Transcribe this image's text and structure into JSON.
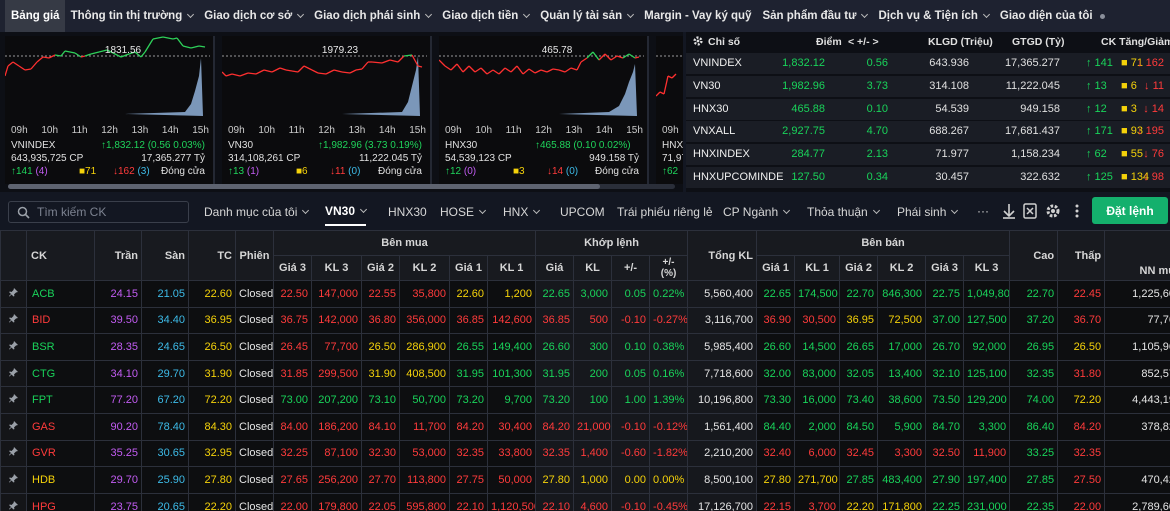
{
  "nav": {
    "items": [
      {
        "label": "Bảng giá",
        "chev": false,
        "dot": false,
        "active": true
      },
      {
        "label": "Thông tin thị trường",
        "chev": true,
        "dot": false
      },
      {
        "label": "Giao dịch cơ sở",
        "chev": true,
        "dot": false
      },
      {
        "label": "Giao dịch phái sinh",
        "chev": true,
        "dot": false
      },
      {
        "label": "Giao dịch tiền",
        "chev": true,
        "dot": false
      },
      {
        "label": "Quản lý tài sản",
        "chev": true,
        "dot": false
      },
      {
        "label": "Margin - Vay ký quỹ",
        "chev": false,
        "dot": false
      },
      {
        "label": "Sản phẩm đầu tư",
        "chev": true,
        "dot": false
      },
      {
        "label": "Dịch vụ & Tiện ích",
        "chev": true,
        "dot": false
      },
      {
        "label": "Giao diện của tôi",
        "chev": false,
        "dot": true
      }
    ]
  },
  "charts": [
    {
      "name": "VNINDEX",
      "ref_label": "1831.56",
      "change": "↑1,832.12 (0.56 0.03%)",
      "volume": "643,935,725 CP",
      "value": "17,365.277 Tỷ",
      "up": "↑141",
      "up_ceil": "(4)",
      "ref": "■71",
      "down": "↓162",
      "down_floor": "(3)",
      "status": "Đóng cửa",
      "ticks": [
        "09h",
        "10h",
        "11h",
        "12h",
        "13h",
        "14h",
        "15h"
      ],
      "intraday": [
        [
          0,
          40
        ],
        [
          3,
          30
        ],
        [
          8,
          26
        ],
        [
          14,
          30
        ],
        [
          20,
          34
        ],
        [
          26,
          33
        ],
        [
          32,
          26
        ],
        [
          38,
          21
        ],
        [
          44,
          22
        ],
        [
          50,
          19
        ],
        [
          56,
          20
        ],
        [
          60,
          15
        ],
        [
          70,
          17
        ],
        [
          76,
          21
        ],
        [
          80,
          20
        ],
        [
          86,
          18
        ],
        [
          94,
          16
        ],
        [
          102,
          14
        ],
        [
          108,
          17
        ],
        [
          116,
          21
        ],
        [
          124,
          18
        ],
        [
          130,
          16
        ],
        [
          136,
          21
        ],
        [
          140,
          16
        ],
        [
          148,
          3
        ],
        [
          158,
          1
        ],
        [
          168,
          3
        ],
        [
          172,
          2
        ],
        [
          178,
          10
        ],
        [
          186,
          12
        ],
        [
          194,
          10
        ],
        [
          200,
          11
        ]
      ],
      "volume_curve": [
        [
          120,
          78
        ],
        [
          180,
          76
        ],
        [
          186,
          68
        ],
        [
          190,
          55
        ],
        [
          194,
          40
        ],
        [
          196,
          22
        ],
        [
          198,
          80
        ]
      ]
    },
    {
      "name": "VN30",
      "ref_label": "1979.23",
      "change": "↑1,982.96 (3.73 0.19%)",
      "volume": "314,108,261 CP",
      "value": "11,222.045 Tỷ",
      "up": "↑13",
      "up_ceil": "(1)",
      "ref": "■6",
      "down": "↓11",
      "down_floor": "(0)",
      "status": "Đóng cửa",
      "ticks": [
        "09h",
        "10h",
        "11h",
        "12h",
        "13h",
        "14h",
        "15h"
      ],
      "intraday": [
        [
          0,
          36
        ],
        [
          4,
          40
        ],
        [
          10,
          38
        ],
        [
          18,
          40
        ],
        [
          26,
          37
        ],
        [
          34,
          38
        ],
        [
          42,
          34
        ],
        [
          50,
          36
        ],
        [
          58,
          32
        ],
        [
          64,
          34
        ],
        [
          70,
          35
        ],
        [
          76,
          36
        ],
        [
          82,
          30
        ],
        [
          90,
          34
        ],
        [
          96,
          37
        ],
        [
          104,
          38
        ],
        [
          112,
          34
        ],
        [
          120,
          36
        ],
        [
          128,
          37
        ],
        [
          134,
          34
        ],
        [
          140,
          33
        ],
        [
          146,
          26
        ],
        [
          150,
          26
        ],
        [
          160,
          27
        ],
        [
          168,
          24
        ],
        [
          176,
          26
        ],
        [
          182,
          20
        ],
        [
          190,
          19
        ],
        [
          196,
          30
        ],
        [
          200,
          31
        ]
      ],
      "volume_curve": [
        [
          120,
          78
        ],
        [
          180,
          76
        ],
        [
          186,
          66
        ],
        [
          190,
          50
        ],
        [
          194,
          34
        ],
        [
          196,
          20
        ],
        [
          198,
          80
        ]
      ]
    },
    {
      "name": "HNX30",
      "ref_label": "465.78",
      "change": "↑465.88 (0.10 0.02%)",
      "volume": "54,539,123 CP",
      "value": "949.158 Tỷ",
      "up": "↑12",
      "up_ceil": "(0)",
      "ref": "■3",
      "down": "↓14",
      "down_floor": "(0)",
      "status": "Đóng cửa",
      "ticks": [
        "09h",
        "10h",
        "11h",
        "12h",
        "13h",
        "14h",
        "15h"
      ],
      "intraday": [
        [
          0,
          24
        ],
        [
          6,
          30
        ],
        [
          12,
          34
        ],
        [
          18,
          28
        ],
        [
          24,
          36
        ],
        [
          30,
          30
        ],
        [
          36,
          36
        ],
        [
          42,
          32
        ],
        [
          48,
          38
        ],
        [
          54,
          34
        ],
        [
          60,
          38
        ],
        [
          66,
          32
        ],
        [
          72,
          36
        ],
        [
          78,
          30
        ],
        [
          84,
          38
        ],
        [
          90,
          33
        ],
        [
          96,
          37
        ],
        [
          102,
          34
        ],
        [
          108,
          36
        ],
        [
          114,
          33
        ],
        [
          120,
          34
        ],
        [
          126,
          36
        ],
        [
          132,
          32
        ],
        [
          138,
          34
        ],
        [
          142,
          26
        ],
        [
          148,
          22
        ],
        [
          154,
          16
        ],
        [
          160,
          24
        ],
        [
          166,
          18
        ],
        [
          172,
          24
        ],
        [
          178,
          20
        ],
        [
          184,
          22
        ],
        [
          190,
          18
        ],
        [
          196,
          22
        ],
        [
          200,
          21
        ]
      ],
      "volume_curve": [
        [
          120,
          78
        ],
        [
          170,
          76
        ],
        [
          180,
          70
        ],
        [
          186,
          58
        ],
        [
          190,
          46
        ],
        [
          194,
          36
        ],
        [
          196,
          28
        ],
        [
          198,
          80
        ]
      ]
    },
    {
      "name": "HNXINDEX",
      "ref_label": "",
      "change": "",
      "volume": "71,97",
      "value": "",
      "up": "↑62",
      "up_ceil": "",
      "ref": "",
      "down": "",
      "down_floor": "",
      "status": "",
      "ticks": [
        "09h",
        "10h"
      ],
      "intraday": [
        [
          0,
          60
        ],
        [
          4,
          56
        ],
        [
          8,
          58
        ],
        [
          12,
          40
        ],
        [
          16,
          42
        ],
        [
          20,
          38
        ]
      ],
      "volume_curve": [
        [
          0,
          80
        ],
        [
          20,
          80
        ]
      ]
    }
  ],
  "indices": {
    "headers": {
      "name": "Chỉ số",
      "point": "Điểm",
      "change": "< +/- >",
      "vol": "KLGD (Triệu)",
      "val": "GTGD (Tỷ)",
      "breadth": "CK Tăng/Giảm"
    },
    "rows": [
      {
        "name": "VNINDEX",
        "point": "1,832.12",
        "change": "0.56",
        "vol": "643.936",
        "val": "17,365.277",
        "up": "↑ 141",
        "ref": "■ 71",
        "down": "↓ 162"
      },
      {
        "name": "VN30",
        "point": "1,982.96",
        "change": "3.73",
        "vol": "314.108",
        "val": "11,222.045",
        "up": "↑ 13",
        "ref": "■ 6",
        "down": "↓ 11"
      },
      {
        "name": "HNX30",
        "point": "465.88",
        "change": "0.10",
        "vol": "54.539",
        "val": "949.158",
        "up": "↑ 12",
        "ref": "■ 3",
        "down": "↓ 14"
      },
      {
        "name": "VNXALL",
        "point": "2,927.75",
        "change": "4.70",
        "vol": "688.267",
        "val": "17,681.437",
        "up": "↑ 171",
        "ref": "■ 93",
        "down": "↓ 195"
      },
      {
        "name": "HNXINDEX",
        "point": "284.77",
        "change": "2.13",
        "vol": "71.977",
        "val": "1,158.234",
        "up": "↑ 62",
        "ref": "■ 55",
        "down": "↓ 76"
      },
      {
        "name": "HNXUPCOMINDE",
        "point": "127.50",
        "change": "0.34",
        "vol": "30.457",
        "val": "322.632",
        "up": "↑ 125",
        "ref": "■ 134",
        "down": "↓ 98"
      }
    ]
  },
  "toolbar": {
    "search_placeholder": "Tìm kiếm CK",
    "tabs": [
      {
        "label": "Danh mục của tôi",
        "chev": true
      },
      {
        "label": "VN30",
        "chev": true,
        "active": true
      },
      {
        "label": "HNX30",
        "chev": false
      },
      {
        "label": "HOSE",
        "chev": true
      },
      {
        "label": "HNX",
        "chev": true
      },
      {
        "label": "UPCOM",
        "chev": false
      },
      {
        "label": "Trái phiếu riêng lẻ",
        "chev": false
      },
      {
        "label": "CP Ngành",
        "chev": true
      },
      {
        "label": "Thỏa thuận",
        "chev": true
      },
      {
        "label": "Phái sinh",
        "chev": true
      }
    ],
    "more": "···",
    "order_button": "Đặt lệnh"
  },
  "board": {
    "headers": {
      "ck": "CK",
      "ceil": "Trần",
      "floor": "Sàn",
      "ref": "TC",
      "session": "Phiên",
      "buy_group": "Bên mua",
      "match_group": "Khớp lệnh",
      "total_vol": "Tổng KL",
      "sell_group": "Bên bán",
      "high": "Cao",
      "low": "Thấp",
      "foreign": "NN mua",
      "p3": "Giá 3",
      "v3": "KL 3",
      "p2": "Giá 2",
      "v2": "KL 2",
      "p1": "Giá 1",
      "v1": "KL 1",
      "mp": "Giá",
      "mv": "KL",
      "mchg": "+/-",
      "mpct": "+/-\n(%)"
    },
    "colors": {
      "up": "#19d35a",
      "down": "#ff3b3b",
      "ref": "#f5d20a",
      "ceil": "#c25cf2",
      "floor": "#3dbbe8",
      "text": "#e5e5e5"
    },
    "rows": [
      [
        "ACB",
        "24.15",
        "21.05",
        "22.60",
        "Closed",
        "22.50",
        "147,000",
        "22.55",
        "35,800",
        "22.60",
        "1,200",
        "22.65",
        "3,000",
        "0.05",
        "0.22%",
        "5,560,400",
        "22.65",
        "174,500",
        "22.70",
        "846,300",
        "22.75",
        "1,049,800",
        "22.70",
        "22.45",
        "1,225,600"
      ],
      [
        "BID",
        "39.50",
        "34.40",
        "36.95",
        "Closed",
        "36.75",
        "142,000",
        "36.80",
        "356,000",
        "36.85",
        "142,600",
        "36.85",
        "500",
        "-0.10",
        "-0.27%",
        "3,116,700",
        "36.90",
        "30,500",
        "36.95",
        "72,500",
        "37.00",
        "127,500",
        "37.20",
        "36.70",
        "77,768"
      ],
      [
        "BSR",
        "28.35",
        "24.65",
        "26.50",
        "Closed",
        "26.45",
        "77,700",
        "26.50",
        "286,900",
        "26.55",
        "149,400",
        "26.60",
        "300",
        "0.10",
        "0.38%",
        "5,985,400",
        "26.60",
        "14,500",
        "26.65",
        "17,000",
        "26.70",
        "92,000",
        "26.95",
        "26.50",
        "1,105,960"
      ],
      [
        "CTG",
        "34.10",
        "29.70",
        "31.90",
        "Closed",
        "31.85",
        "299,500",
        "31.90",
        "408,500",
        "31.95",
        "101,300",
        "31.95",
        "200",
        "0.05",
        "0.16%",
        "7,718,600",
        "32.00",
        "83,000",
        "32.05",
        "13,400",
        "32.10",
        "125,100",
        "32.35",
        "31.80",
        "852,574"
      ],
      [
        "FPT",
        "77.20",
        "67.20",
        "72.20",
        "Closed",
        "73.00",
        "207,200",
        "73.10",
        "50,700",
        "73.20",
        "9,700",
        "73.20",
        "100",
        "1.00",
        "1.39%",
        "10,196,800",
        "73.30",
        "16,000",
        "73.40",
        "38,600",
        "73.50",
        "129,200",
        "74.00",
        "72.20",
        "4,443,191"
      ],
      [
        "GAS",
        "90.20",
        "78.40",
        "84.30",
        "Closed",
        "84.00",
        "186,200",
        "84.10",
        "11,700",
        "84.20",
        "30,400",
        "84.20",
        "21,000",
        "-0.10",
        "-0.12%",
        "1,561,400",
        "84.40",
        "2,000",
        "84.50",
        "5,900",
        "84.70",
        "3,300",
        "86.40",
        "84.20",
        "378,829"
      ],
      [
        "GVR",
        "35.25",
        "30.65",
        "32.95",
        "Closed",
        "32.25",
        "87,100",
        "32.30",
        "53,000",
        "32.35",
        "33,800",
        "32.35",
        "1,400",
        "-0.60",
        "-1.82%",
        "2,210,200",
        "32.40",
        "6,000",
        "32.45",
        "3,300",
        "32.50",
        "11,900",
        "33.25",
        "32.35",
        ""
      ],
      [
        "HDB",
        "29.70",
        "25.90",
        "27.80",
        "Closed",
        "27.65",
        "256,200",
        "27.70",
        "113,800",
        "27.75",
        "50,000",
        "27.80",
        "1,000",
        "0.00",
        "0.00%",
        "8,500,100",
        "27.80",
        "271,700",
        "27.85",
        "483,400",
        "27.90",
        "197,400",
        "27.85",
        "27.50",
        "470,427"
      ],
      [
        "HPG",
        "23.75",
        "20.65",
        "22.20",
        "Closed",
        "22.00",
        "179,800",
        "22.05",
        "595,800",
        "22.10",
        "1,120,500",
        "22.10",
        "4,600",
        "-0.10",
        "-0.45%",
        "17,126,700",
        "22.15",
        "3,700",
        "22.20",
        "171,800",
        "22.25",
        "231,000",
        "22.35",
        "22.00",
        "2,789,603"
      ]
    ]
  }
}
